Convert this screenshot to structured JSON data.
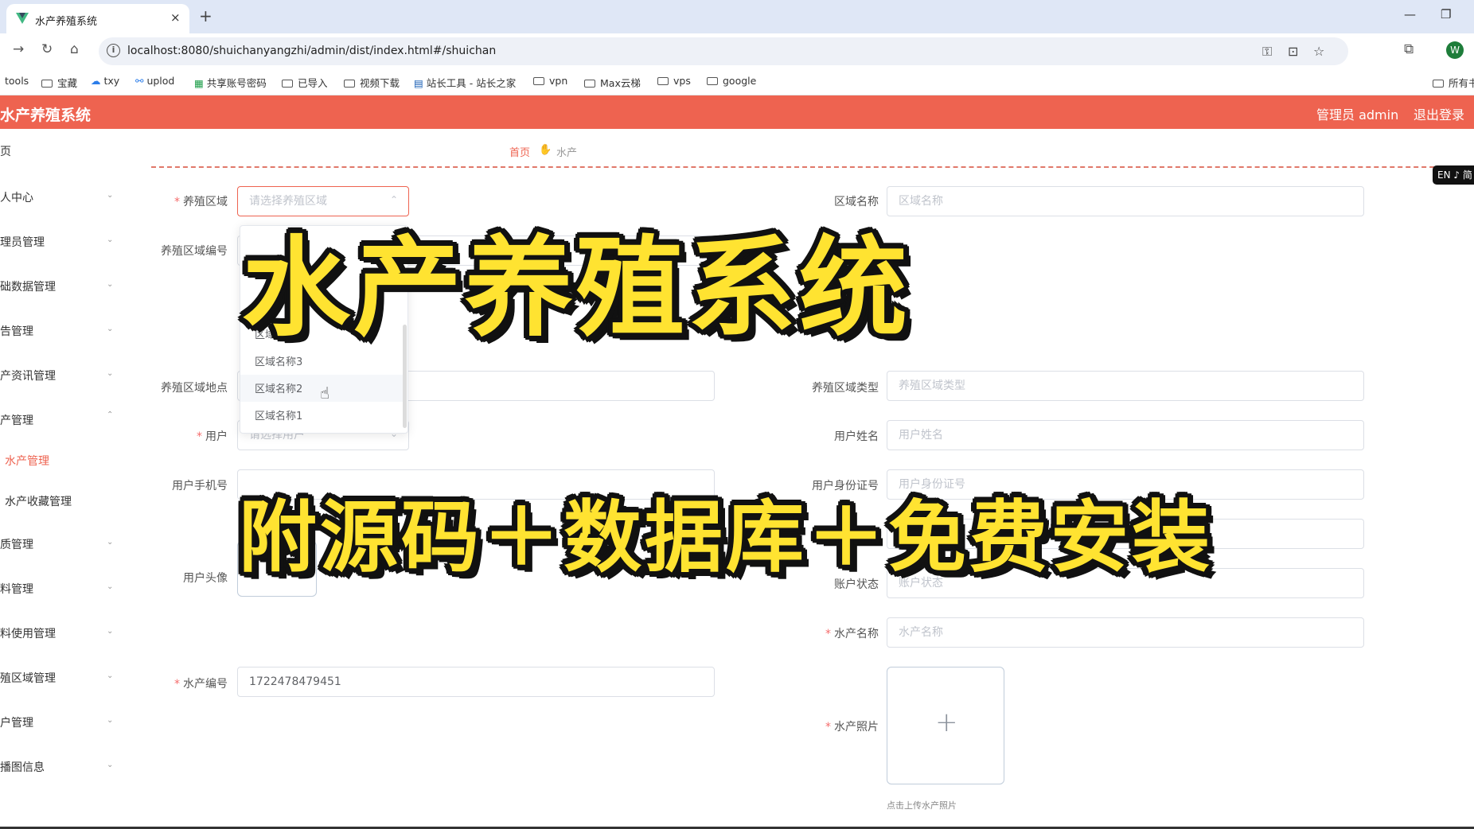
{
  "browser": {
    "tab_title": "水产养殖系统",
    "tab_close": "×",
    "new_tab": "+",
    "url": "localhost:8080/shuichanyangzhi/admin/dist/index.html#/shuichan",
    "profile_initial": "W",
    "bookmarks": [
      "tools",
      "宝藏",
      "txy",
      "uplod",
      "共享账号密码",
      "已导入",
      "视频下载",
      "站长工具 - 站长之家",
      "vpn",
      "Max云梯",
      "vps",
      "google",
      "所有书"
    ]
  },
  "app": {
    "title": "水产养殖系统",
    "user_label": "管理员 admin",
    "logout": "退出登录",
    "accent_color": "#ee6350"
  },
  "sidebar": {
    "items": [
      "页",
      "人中心",
      "理员管理",
      "础数据管理",
      "告管理",
      "产资讯管理",
      "产管理",
      "水产管理",
      "水产收藏管理",
      "质管理",
      "料管理",
      "料使用管理",
      "殖区域管理",
      "户管理",
      "播图信息"
    ]
  },
  "breadcrumb": {
    "home": "首页",
    "current": "水产"
  },
  "lang_badge": "EN ♪ 简",
  "form": {
    "area_label": "养殖区域",
    "area_placeholder": "请选择养殖区域",
    "area_name_label": "区域名称",
    "area_name_placeholder": "区域名称",
    "area_code_label": "养殖区域编号",
    "area_location_label": "养殖区域地点",
    "area_type_label": "养殖区域类型",
    "area_type_placeholder": "养殖区域类型",
    "user_label": "用户",
    "user_placeholder": "请选择用户",
    "user_name_label": "用户姓名",
    "user_name_placeholder": "用户姓名",
    "user_phone_label": "用户手机号",
    "user_id_label": "用户身份证号",
    "user_id_placeholder": "用户身份证号",
    "user_avatar_label": "用户头像",
    "account_status_label": "账户状态",
    "account_status_placeholder": "账户状态",
    "aquatic_name_label": "水产名称",
    "aquatic_name_placeholder": "水产名称",
    "aquatic_code_label": "水产编号",
    "aquatic_code_value": "1722478479451",
    "aquatic_photo_label": "水产照片",
    "upload_hint": "点击上传水产照片"
  },
  "dropdown": {
    "options": [
      "区域名称4",
      "区域名称3",
      "区域名称2",
      "区域名称1"
    ],
    "hovered": "区域名称2"
  },
  "overlay": {
    "headline": "水产养殖系统",
    "subline": "附源码＋数据库＋免费安装"
  }
}
